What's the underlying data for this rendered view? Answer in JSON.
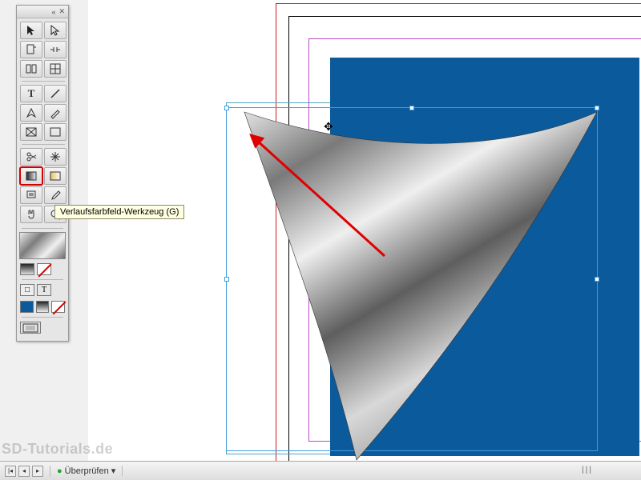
{
  "toolbox": {
    "header": {
      "collapse": "«",
      "close": "✕"
    },
    "tools": [
      [
        {
          "name": "selection-tool",
          "glyph": "arrow-solid"
        },
        {
          "name": "direct-selection-tool",
          "glyph": "arrow-hollow"
        }
      ],
      [
        {
          "name": "page-tool",
          "glyph": "page"
        },
        {
          "name": "gap-tool",
          "glyph": "gap"
        }
      ],
      [
        {
          "name": "content-tool",
          "glyph": "content"
        },
        {
          "name": "content-tool-2",
          "glyph": "content2"
        }
      ],
      [
        {
          "name": "type-tool",
          "glyph": "T"
        },
        {
          "name": "line-tool",
          "glyph": "line"
        }
      ],
      [
        {
          "name": "pen-tool",
          "glyph": "pen"
        },
        {
          "name": "pencil-tool",
          "glyph": "pencil"
        }
      ],
      [
        {
          "name": "rectangle-frame-tool",
          "glyph": "rect-x"
        },
        {
          "name": "rectangle-tool",
          "glyph": "rect"
        }
      ],
      [
        {
          "name": "scissors-tool",
          "glyph": "scissors"
        },
        {
          "name": "transform-tool",
          "glyph": "transform"
        }
      ],
      [
        {
          "name": "gradient-swatch-tool",
          "glyph": "gradient",
          "selected": true
        },
        {
          "name": "gradient-feather-tool",
          "glyph": "gradient-feather"
        }
      ],
      [
        {
          "name": "note-tool",
          "glyph": "note"
        },
        {
          "name": "eyedropper-tool",
          "glyph": "eyedropper"
        }
      ],
      [
        {
          "name": "hand-tool",
          "glyph": "hand"
        },
        {
          "name": "zoom-tool",
          "glyph": "zoom"
        }
      ]
    ],
    "format_row": {
      "frame": "□",
      "text": "T"
    },
    "swatches": {
      "fill": "blue",
      "stroke": "none"
    }
  },
  "tooltip": {
    "text": "Verlaufsfarbfeld-Werkzeug (G)"
  },
  "canvas": {
    "blue_rect_color": "#0b5a9c",
    "sail_gradient": [
      "#dedede",
      "#6a6a6a",
      "#f2f2f2",
      "#5c5c5c",
      "#cfcfcf"
    ],
    "arrow_color": "#e00000"
  },
  "statusbar": {
    "preflight_label": "Überprüfen",
    "preflight_icon": "●"
  },
  "watermark": "SD-Tutorials.de"
}
